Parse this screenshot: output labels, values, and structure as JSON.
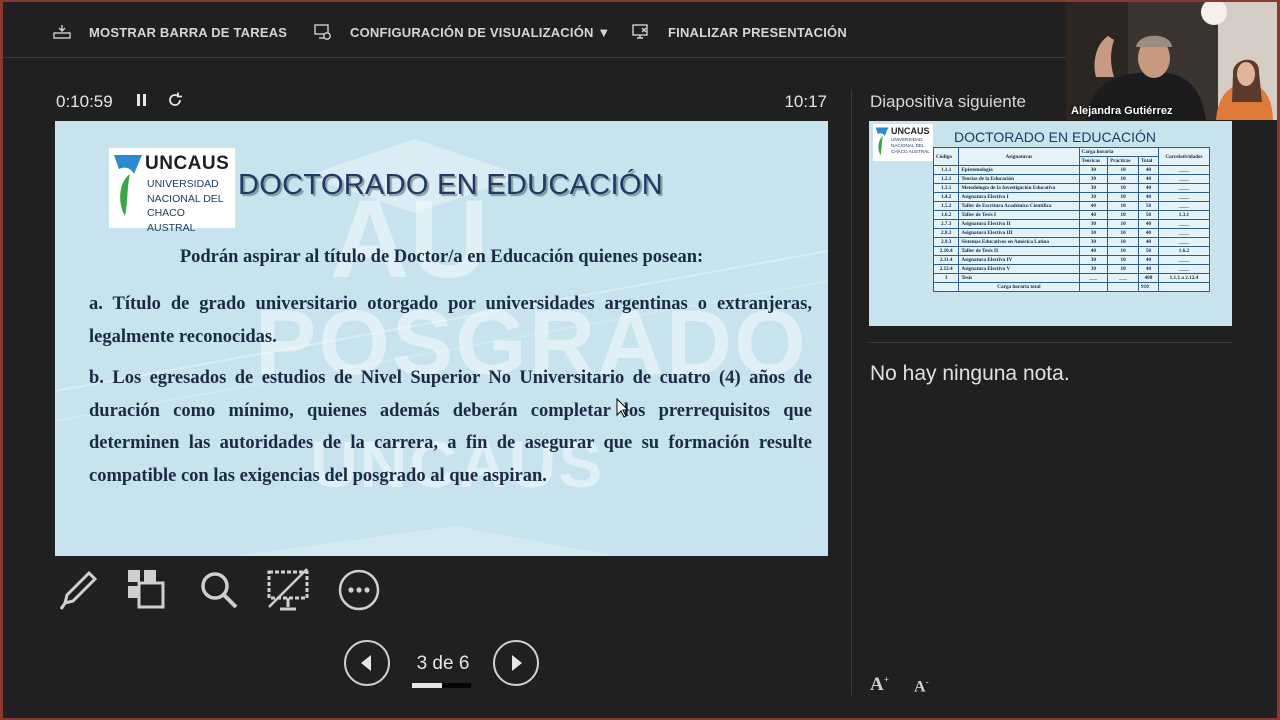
{
  "toolbar": {
    "show_taskbar": "MOSTRAR BARRA DE TAREAS",
    "display_settings": "CONFIGURACIÓN DE VISUALIZACIÓN ▼",
    "end_show": "FINALIZAR PRESENTACIÓN"
  },
  "presenter": {
    "elapsed_time": "0:10:59",
    "clock": "10:17",
    "slide_counter": "3 de 6",
    "progress": 0.5,
    "next_slide_label": "Diapositiva siguiente",
    "notes": "No hay ninguna nota."
  },
  "slide": {
    "logo_name": "UNCAUS",
    "logo_lines": [
      "UNIVERSIDAD",
      "NACIONAL DEL",
      "CHACO AUSTRAL"
    ],
    "watermark_top": "AU",
    "watermark_mid": "POSGRADO",
    "watermark_low": "UNCAUS",
    "title": "DOCTORADO EN EDUCACIÓN",
    "intro": "Podrán aspirar al título de Doctor/a en Educación  quienes posean:",
    "item_a": "a. Título de grado universitario otorgado por universidades argentinas o extranjeras, legalmente reconocidas.",
    "item_b": "b. Los egresados de estudios de Nivel Superior No Universitario de cuatro (4) años de duración como mínimo, quienes además deberán completar los prerrequisitos que determinen las autoridades de la carrera, a fin de asegurar que su formación resulte compatible con las exigencias del posgrado al que aspiran."
  },
  "next_slide": {
    "title": "DOCTORADO EN EDUCACIÓN",
    "headers": [
      "Código",
      "Asignaturas",
      "Carga horaria",
      "Correlatividades"
    ],
    "subheaders": [
      "Teóricas",
      "Prácticas",
      "Total"
    ],
    "rows": [
      [
        "1.1.1",
        "Epistemología",
        "30",
        "10",
        "40",
        "____"
      ],
      [
        "1.2.1",
        "Teorías de la Educación",
        "30",
        "10",
        "40",
        "____"
      ],
      [
        "1.3.1",
        "Metodología de la Investigación Educativa",
        "30",
        "10",
        "40",
        "____"
      ],
      [
        "1.4.2",
        "Asignatura Electiva I",
        "30",
        "10",
        "40",
        "____"
      ],
      [
        "1.5.2",
        "Taller de Escritura Académico Científica",
        "40",
        "10",
        "50",
        "____"
      ],
      [
        "1.6.2",
        "Taller de Tesis I",
        "40",
        "10",
        "50",
        "1.3.1"
      ],
      [
        "2.7.3",
        "Asignatura Electiva II",
        "30",
        "10",
        "40",
        "____"
      ],
      [
        "2.8.3",
        "Asignatura Electiva III",
        "30",
        "10",
        "40",
        "____"
      ],
      [
        "2.9.3",
        "Sistemas Educativos en América Latina",
        "30",
        "10",
        "40",
        "____"
      ],
      [
        "2.10.4",
        "Taller de Tesis II",
        "40",
        "10",
        "50",
        "1.6.2"
      ],
      [
        "2.11.4",
        "Asignatura Electiva IV",
        "30",
        "10",
        "40",
        "____"
      ],
      [
        "2.12.4",
        "Asignatura Electiva V",
        "30",
        "10",
        "40",
        "____"
      ],
      [
        "3",
        "Tesis",
        "___",
        "___",
        "400",
        "1.1.1 a 2.12.4"
      ]
    ],
    "total_label": "Carga horaria total",
    "total_value": "910"
  },
  "webcam": {
    "participant": "Alejandra Gutiérrez"
  },
  "colors": {
    "slide_bg": "#c6e3ee",
    "title": "#1f3a66",
    "logo_blue": "#2a8ccf",
    "logo_green": "#3aa64a"
  }
}
